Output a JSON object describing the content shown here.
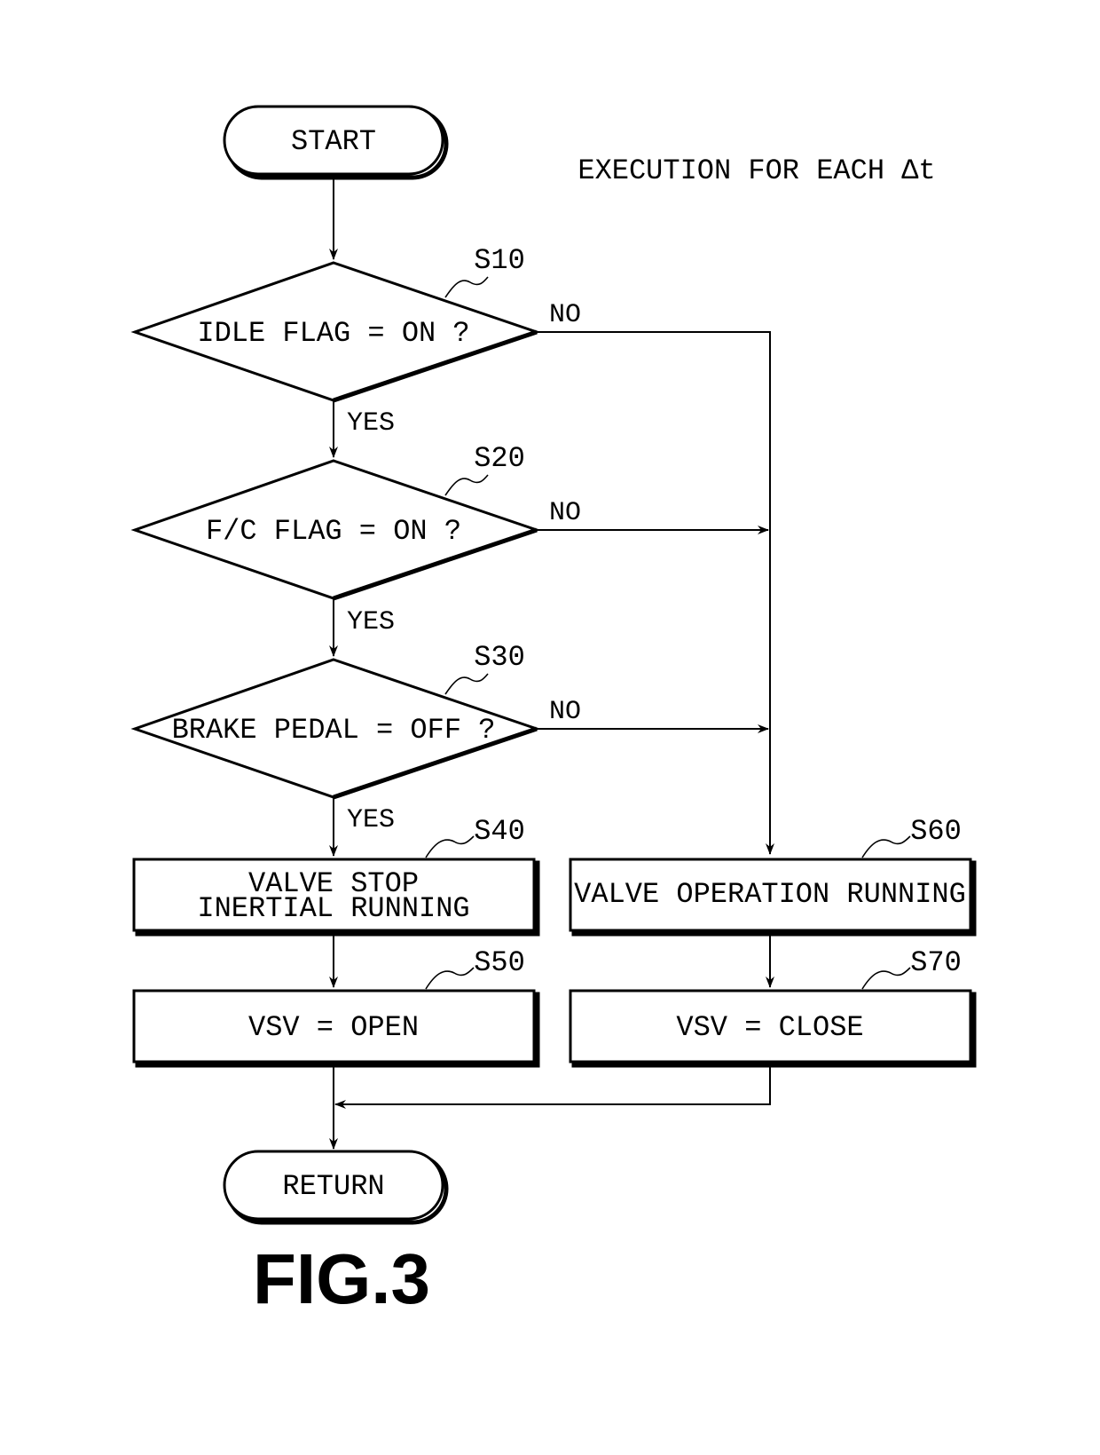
{
  "diagram": {
    "note": "EXECUTION FOR EACH Δt",
    "figure_label": "FIG.3",
    "terminals": {
      "start": "START",
      "end": "RETURN"
    },
    "decisions": [
      {
        "step": "S10",
        "text": "IDLE FLAG = ON ?",
        "yes": "YES",
        "no": "NO"
      },
      {
        "step": "S20",
        "text": "F/C FLAG = ON ?",
        "yes": "YES",
        "no": "NO"
      },
      {
        "step": "S30",
        "text": "BRAKE PEDAL = OFF ?",
        "yes": "YES",
        "no": "NO"
      }
    ],
    "processes": {
      "s40": {
        "step": "S40",
        "line1": "VALVE STOP",
        "line2": "INERTIAL RUNNING"
      },
      "s50": {
        "step": "S50",
        "text": "VSV = OPEN"
      },
      "s60": {
        "step": "S60",
        "text": "VALVE OPERATION RUNNING"
      },
      "s70": {
        "step": "S70",
        "text": "VSV = CLOSE"
      }
    },
    "edges": [
      {
        "from": "START",
        "to": "S10"
      },
      {
        "from": "S10",
        "to": "S20",
        "label": "YES"
      },
      {
        "from": "S10",
        "to": "S60",
        "label": "NO"
      },
      {
        "from": "S20",
        "to": "S30",
        "label": "YES"
      },
      {
        "from": "S20",
        "to": "S60",
        "label": "NO"
      },
      {
        "from": "S30",
        "to": "S40",
        "label": "YES"
      },
      {
        "from": "S30",
        "to": "S60",
        "label": "NO"
      },
      {
        "from": "S40",
        "to": "S50"
      },
      {
        "from": "S60",
        "to": "S70"
      },
      {
        "from": "S50",
        "to": "RETURN"
      },
      {
        "from": "S70",
        "to": "RETURN"
      }
    ]
  }
}
